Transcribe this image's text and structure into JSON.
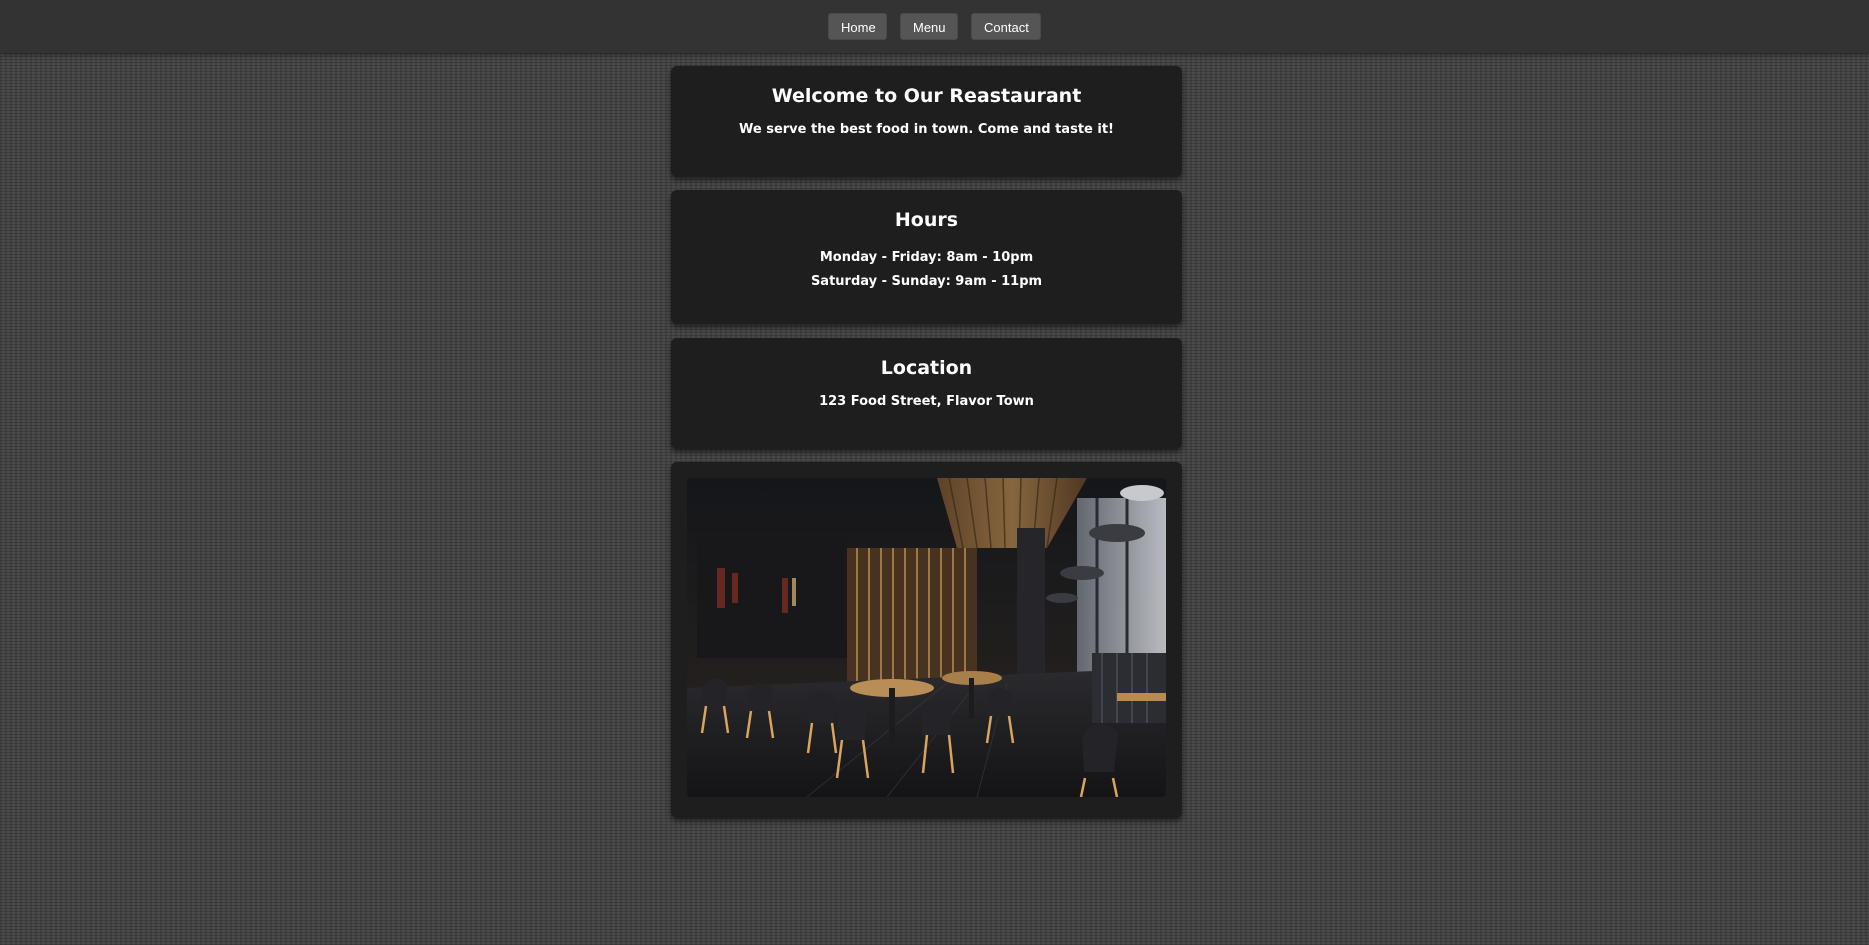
{
  "nav": {
    "home": "Home",
    "menu": "Menu",
    "contact": "Contact"
  },
  "welcome": {
    "title": "Welcome to Our Reastaurant",
    "text": "We serve the best food in town. Come and taste it!"
  },
  "hours": {
    "title": "Hours",
    "weekdays": "Monday - Friday: 8am - 10pm",
    "weekend": "Saturday - Sunday: 9am - 11pm"
  },
  "location": {
    "title": "Location",
    "address": "123 Food Street, Flavor Town"
  },
  "photo": {
    "subject": "restaurant-interior-photo"
  },
  "colors": {
    "navbar": "#333333",
    "nav_button": "#555555",
    "card": "#1e1e1e",
    "page_background": "#404040",
    "text": "#ffffff"
  }
}
